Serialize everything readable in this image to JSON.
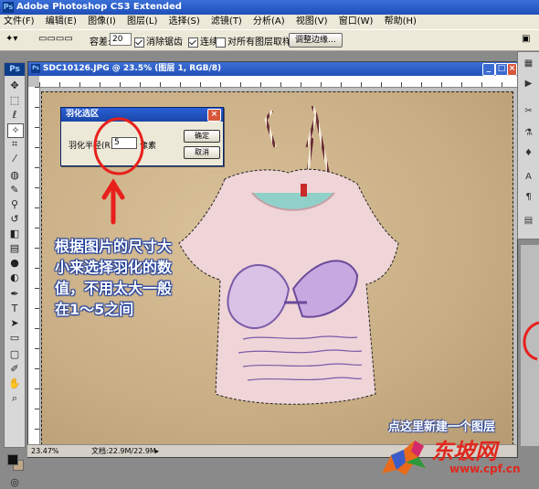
{
  "app": {
    "title": "Adobe Photoshop CS3 Extended",
    "icon": "photoshop-icon"
  },
  "menu": [
    "文件(F)",
    "编辑(E)",
    "图像(I)",
    "图层(L)",
    "选择(S)",
    "滤镜(T)",
    "分析(A)",
    "视图(V)",
    "窗口(W)",
    "帮助(H)"
  ],
  "options": {
    "tolerance_label": "容差:",
    "tolerance_value": "20",
    "antialias_label": "消除锯齿",
    "contiguous_label": "连续",
    "all_layers_label": "对所有图层取样",
    "refine_edge_label": "调整边缘..."
  },
  "toolbox": {
    "logo": "Ps"
  },
  "document": {
    "title": "SDC10126.JPG @ 23.5% (图层 1, RGB/8)"
  },
  "status": {
    "zoom": "23.47%",
    "doc_size": "文档:22.9M/22.9M"
  },
  "dialog": {
    "title": "羽化选区",
    "label": "羽化半径(R):",
    "value": "5",
    "unit": "像素",
    "ok_label": "确定",
    "cancel_label": "取消"
  },
  "annotation": {
    "lines": [
      "根据图片的尺寸大",
      "小来选择羽化的数",
      "值，不用太大一般",
      "在1～5之间"
    ],
    "bottom_note": "点这里新建一个图层"
  },
  "watermark": {
    "text": "东坡网",
    "url": "www.cpf.cn"
  }
}
